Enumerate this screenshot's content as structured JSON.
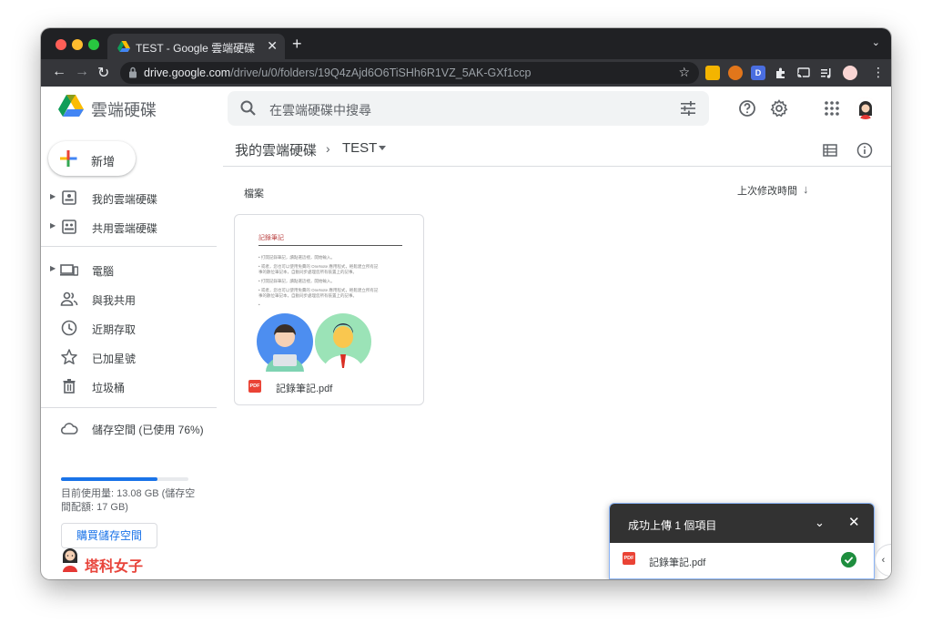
{
  "browser": {
    "tab_title": "TEST - Google 雲端硬碟",
    "tab_close": "✕",
    "new_tab": "+",
    "tab_menu": "⌄",
    "url_host": "drive.google.com",
    "url_path": "/drive/u/0/folders/19Q4zAjd6O6TiSHh6R1VZ_5AK-GXf1ccp",
    "back": "←",
    "forward": "→",
    "reload": "↻",
    "bookmark": "☆",
    "ext_d": "D"
  },
  "app": {
    "brand": "雲端硬碟",
    "search_placeholder": "在雲端硬碟中搜尋"
  },
  "sidebar": {
    "new_label": "新增",
    "items": [
      {
        "label": "我的雲端硬碟",
        "icon": "my-drive-icon"
      },
      {
        "label": "共用雲端硬碟",
        "icon": "shared-drives-icon"
      },
      {
        "label": "電腦",
        "icon": "computers-icon"
      },
      {
        "label": "與我共用",
        "icon": "shared-with-me-icon"
      },
      {
        "label": "近期存取",
        "icon": "recent-icon"
      },
      {
        "label": "已加星號",
        "icon": "starred-icon"
      },
      {
        "label": "垃圾桶",
        "icon": "trash-icon"
      }
    ],
    "storage_label": "儲存空間 (已使用 76%)",
    "storage_used_fraction": 0.76,
    "storage_detail": "目前使用量: 13.08 GB (儲存空間配額: 17 GB)",
    "buy_label": "購買儲存空間",
    "watermark": "塔科女子"
  },
  "main": {
    "breadcrumb_root": "我的雲端硬碟",
    "breadcrumb_sep": "›",
    "breadcrumb_current": "TEST",
    "section_label": "檔案",
    "sort_label": "上次修改時間",
    "sort_arrow": "↓",
    "file": {
      "name": "記錄筆記.pdf",
      "badge": "PDF",
      "doc_title": "記錄筆記",
      "doc_lines": [
        "• 打開記錄筆記，讀點選這裡，開始輸入。",
        "• 或者，您也可以使用免費的 OneNote 應用程式，輕鬆建立所有記",
        "  事的數位筆記本，自動同步處理您所有裝置上的記事。",
        "• 打開記錄筆記，讀點選這裡，開始輸入。",
        "• 或者，您也可以使用免費的 OneNote 應用程式，輕鬆建立所有記",
        "  事的數位筆記本，自動同步處理您所有裝置上的記事。",
        "•"
      ]
    }
  },
  "upload": {
    "title": "成功上傳 1 個項目",
    "collapse": "⌄",
    "close": "✕",
    "file_name": "記錄筆記.pdf",
    "badge": "PDF",
    "side_toggle": "‹"
  },
  "colors": {
    "accent": "#1a73e8",
    "success": "#1e8e3e",
    "pdf": "#ea4335"
  }
}
